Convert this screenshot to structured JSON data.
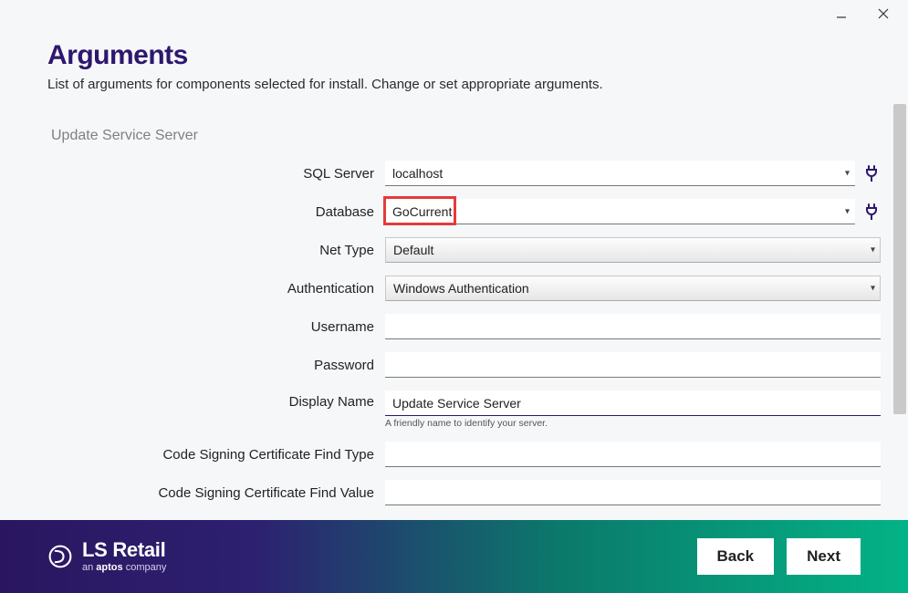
{
  "titlebar": {},
  "header": {
    "title": "Arguments",
    "subtitle": "List of arguments for components selected for install. Change or set appropriate arguments."
  },
  "section": {
    "title": "Update Service Server"
  },
  "fields": {
    "sql_server": {
      "label": "SQL Server",
      "value": "localhost"
    },
    "database": {
      "label": "Database",
      "value": "GoCurrent"
    },
    "net_type": {
      "label": "Net Type",
      "value": "Default"
    },
    "authentication": {
      "label": "Authentication",
      "value": "Windows Authentication"
    },
    "username": {
      "label": "Username",
      "value": ""
    },
    "password": {
      "label": "Password",
      "value": ""
    },
    "display_name": {
      "label": "Display Name",
      "value": "Update Service Server",
      "helper": "A friendly name to identify your server."
    },
    "cert_find_type": {
      "label": "Code Signing Certificate Find Type",
      "value": ""
    },
    "cert_find_value": {
      "label": "Code Signing Certificate Find Value",
      "value": ""
    }
  },
  "footer": {
    "brand_name": "LS Retail",
    "brand_sub_prefix": "an ",
    "brand_sub_bold": "aptos",
    "brand_sub_suffix": " company",
    "back": "Back",
    "next": "Next"
  }
}
